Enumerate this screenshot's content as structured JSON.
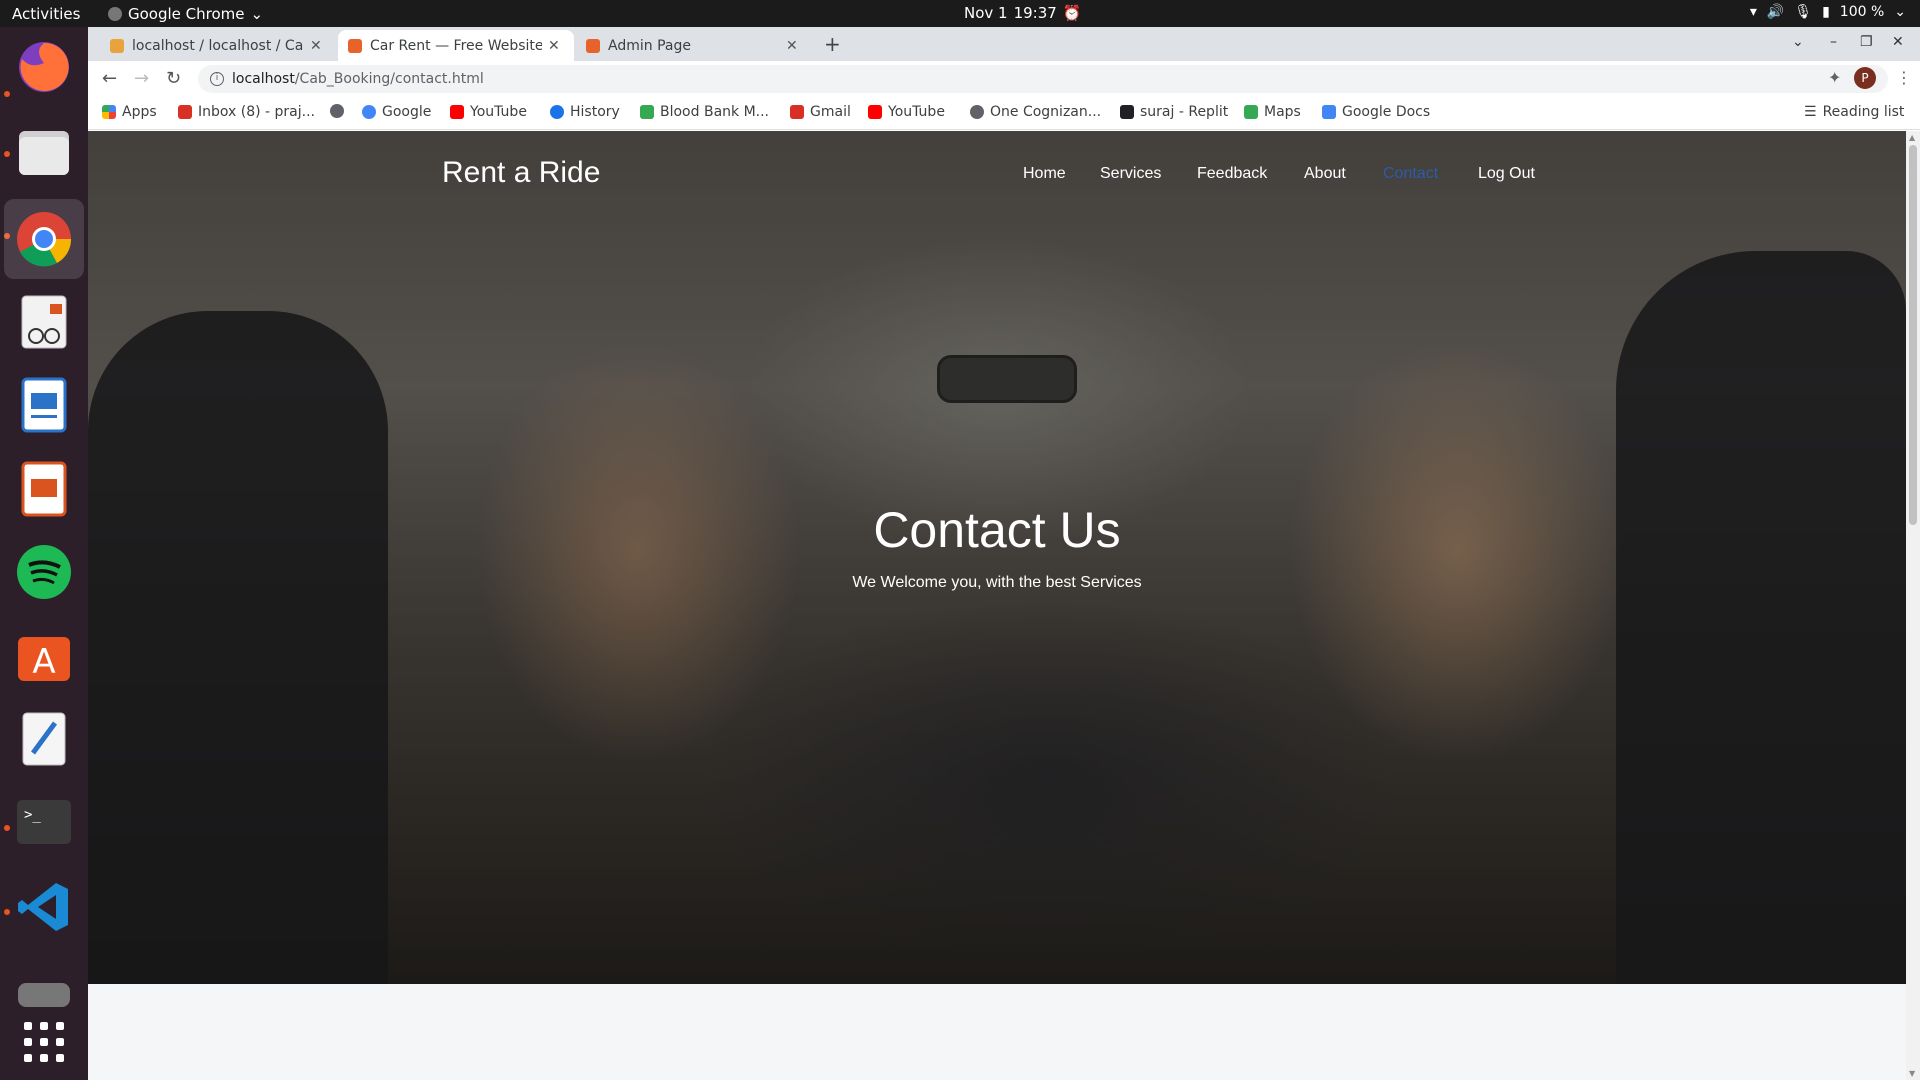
{
  "system": {
    "activities": "Activities",
    "app_menu": "Google Chrome",
    "date": "Nov 1",
    "time": "19:37",
    "battery": "100 %"
  },
  "tabs": [
    {
      "title": "localhost / localhost / Cab",
      "favicon_color": "#e8a33d"
    },
    {
      "title": "Car Rent — Free Website",
      "favicon_color": "#e8632b"
    },
    {
      "title": "Admin Page",
      "favicon_color": "#e8632b"
    }
  ],
  "address": {
    "host": "localhost",
    "path": "/Cab_Booking/contact.html"
  },
  "bookmarks": [
    {
      "label": "Apps",
      "icon": "apps-grid-icon",
      "color": "#4285f4"
    },
    {
      "label": "Inbox (8) - praj...",
      "icon": "gmail-icon",
      "color": "#d93025"
    },
    {
      "label": "",
      "icon": "globe-icon",
      "color": "#5f6368"
    },
    {
      "label": "Google",
      "icon": "google-icon",
      "color": "#4285f4"
    },
    {
      "label": "YouTube",
      "icon": "youtube-icon",
      "color": "#ff0000"
    },
    {
      "label": "History",
      "icon": "history-icon",
      "color": "#1a73e8"
    },
    {
      "label": "Blood Bank M...",
      "icon": "bloodbank-icon",
      "color": "#34a853"
    },
    {
      "label": "Gmail",
      "icon": "gmail-icon",
      "color": "#d93025"
    },
    {
      "label": "YouTube",
      "icon": "youtube-icon",
      "color": "#ff0000"
    },
    {
      "label": "One Cognizan...",
      "icon": "globe-icon",
      "color": "#5f6368"
    },
    {
      "label": "suraj - Replit",
      "icon": "replit-icon",
      "color": "#202124"
    },
    {
      "label": "Maps",
      "icon": "maps-icon",
      "color": "#34a853"
    },
    {
      "label": "Google Docs",
      "icon": "docs-icon",
      "color": "#4285f4"
    }
  ],
  "reading_list": "Reading list",
  "profile_initial": "P",
  "site": {
    "brand": "Rent a Ride",
    "nav": [
      "Home",
      "Services",
      "Feedback",
      "About",
      "Contact",
      "Log Out"
    ],
    "hero_title": "Contact Us",
    "hero_subtitle": "We Welcome you, with the best Services"
  },
  "dock": [
    {
      "name": "firefox-icon",
      "color": "#ff7139",
      "running": false
    },
    {
      "name": "files-icon",
      "color": "#dcdcdc",
      "running": true
    },
    {
      "name": "chrome-icon",
      "color": "#4285f4",
      "running": true,
      "active": true
    },
    {
      "name": "document-viewer-icon",
      "color": "#e0e0e0",
      "running": false
    },
    {
      "name": "writer-icon",
      "color": "#2a73c8",
      "running": false
    },
    {
      "name": "impress-icon",
      "color": "#d9541e",
      "running": false
    },
    {
      "name": "spotify-icon",
      "color": "#1db954",
      "running": false
    },
    {
      "name": "app-center-icon",
      "color": "#e95420",
      "running": false
    },
    {
      "name": "text-editor-icon",
      "color": "#f0f0f0",
      "running": false
    },
    {
      "name": "terminal-icon",
      "color": "#3a3a3a",
      "running": true
    },
    {
      "name": "vscode-icon",
      "color": "#1a8ad4",
      "running": true
    },
    {
      "name": "disk-icon",
      "color": "#666666",
      "running": false
    }
  ]
}
